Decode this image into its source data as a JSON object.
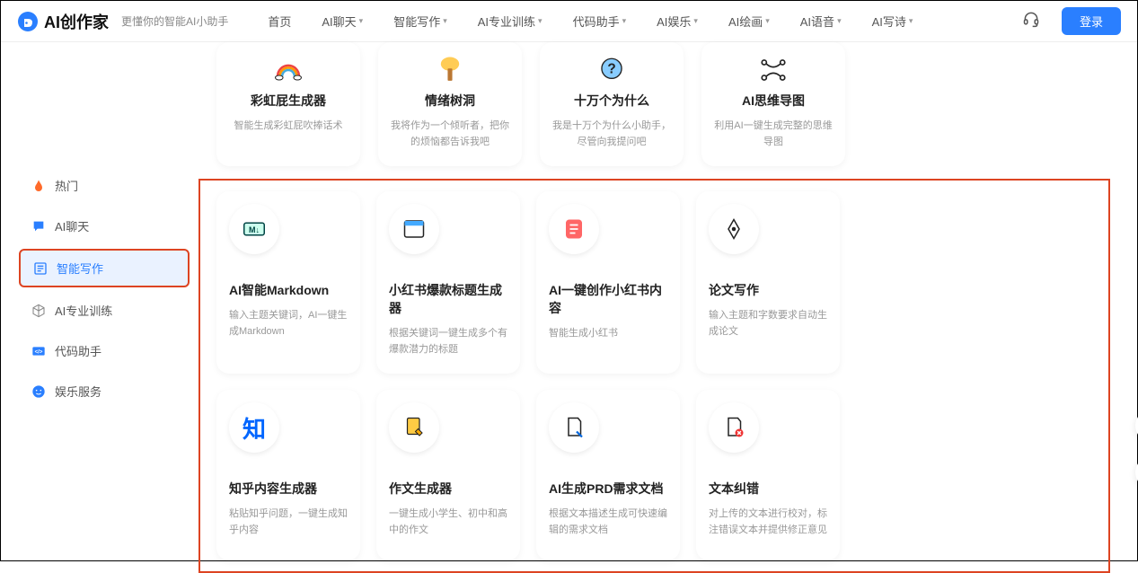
{
  "brand": {
    "name": "AI创作家",
    "tagline": "更懂你的智能AI小助手"
  },
  "nav": {
    "items": [
      {
        "label": "首页",
        "dropdown": false
      },
      {
        "label": "AI聊天",
        "dropdown": true
      },
      {
        "label": "智能写作",
        "dropdown": true
      },
      {
        "label": "AI专业训练",
        "dropdown": true
      },
      {
        "label": "代码助手",
        "dropdown": true
      },
      {
        "label": "AI娱乐",
        "dropdown": true
      },
      {
        "label": "AI绘画",
        "dropdown": true
      },
      {
        "label": "AI语音",
        "dropdown": true
      },
      {
        "label": "AI写诗",
        "dropdown": true
      }
    ],
    "login": "登录"
  },
  "sidebar": {
    "items": [
      {
        "icon": "fire",
        "label": "热门",
        "color": "#ff6a2a"
      },
      {
        "icon": "chat",
        "label": "AI聊天",
        "color": "#2a7fff"
      },
      {
        "icon": "edit",
        "label": "智能写作",
        "color": "#2a7fff",
        "active": true
      },
      {
        "icon": "cube",
        "label": "AI专业训练",
        "color": "#888"
      },
      {
        "icon": "code",
        "label": "代码助手",
        "color": "#2a7fff"
      },
      {
        "icon": "smile",
        "label": "娱乐服务",
        "color": "#2a7fff"
      }
    ]
  },
  "top_cards": [
    {
      "icon": "rainbow",
      "title": "彩虹屁生成器",
      "desc": "智能生成彩虹屁吹捧话术"
    },
    {
      "icon": "tree",
      "title": "情绪树洞",
      "desc": "我将作为一个倾听者，把你的烦恼都告诉我吧"
    },
    {
      "icon": "question",
      "title": "十万个为什么",
      "desc": "我是十万个为什么小助手，尽管向我提问吧"
    },
    {
      "icon": "mindmap",
      "title": "AI思维导图",
      "desc": "利用AI一键生成完整的思维导图"
    }
  ],
  "main_cards": [
    [
      {
        "icon": "markdown",
        "title": "AI智能Markdown",
        "desc": "输入主题关键词，AI一键生成Markdown"
      },
      {
        "icon": "window",
        "title": "小红书爆款标题生成器",
        "desc": "根据关键词一键生成多个有爆款潜力的标题"
      },
      {
        "icon": "note-red",
        "title": "AI一键创作小红书内容",
        "desc": "智能生成小红书"
      },
      {
        "icon": "pen",
        "title": "论文写作",
        "desc": "输入主题和字数要求自动生成论文"
      }
    ],
    [
      {
        "icon": "zhi",
        "title": "知乎内容生成器",
        "desc": "粘贴知乎问题，一键生成知乎内容"
      },
      {
        "icon": "doc-pencil",
        "title": "作文生成器",
        "desc": "一键生成小学生、初中和高中的作文"
      },
      {
        "icon": "doc-edit",
        "title": "AI生成PRD需求文档",
        "desc": "根据文本描述生成可快速编辑的需求文档"
      },
      {
        "icon": "doc-error",
        "title": "文本纠错",
        "desc": "对上传的文本进行校对，标注错误文本并提供修正意见"
      }
    ]
  ]
}
